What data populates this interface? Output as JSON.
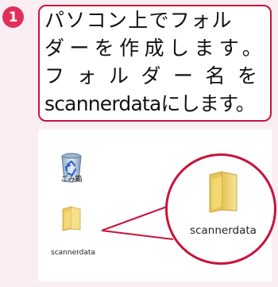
{
  "step": {
    "number": "1"
  },
  "callout": {
    "lines": [
      "パソコン上でフォル",
      "ダーを作成します。",
      "フォルダー名を",
      "scannerdataにします。"
    ]
  },
  "desktop": {
    "recycle_bin": {
      "label": "ごみ箱",
      "icon": "recycle-bin-icon"
    },
    "folder": {
      "label": "scannerdata",
      "icon": "folder-icon"
    }
  },
  "zoom": {
    "folder": {
      "label": "scannerdata",
      "icon": "folder-icon"
    }
  },
  "colors": {
    "accent": "#c8143c",
    "badge": "#e0305a",
    "background": "#fbeef3",
    "folder": "#f0d77a"
  }
}
